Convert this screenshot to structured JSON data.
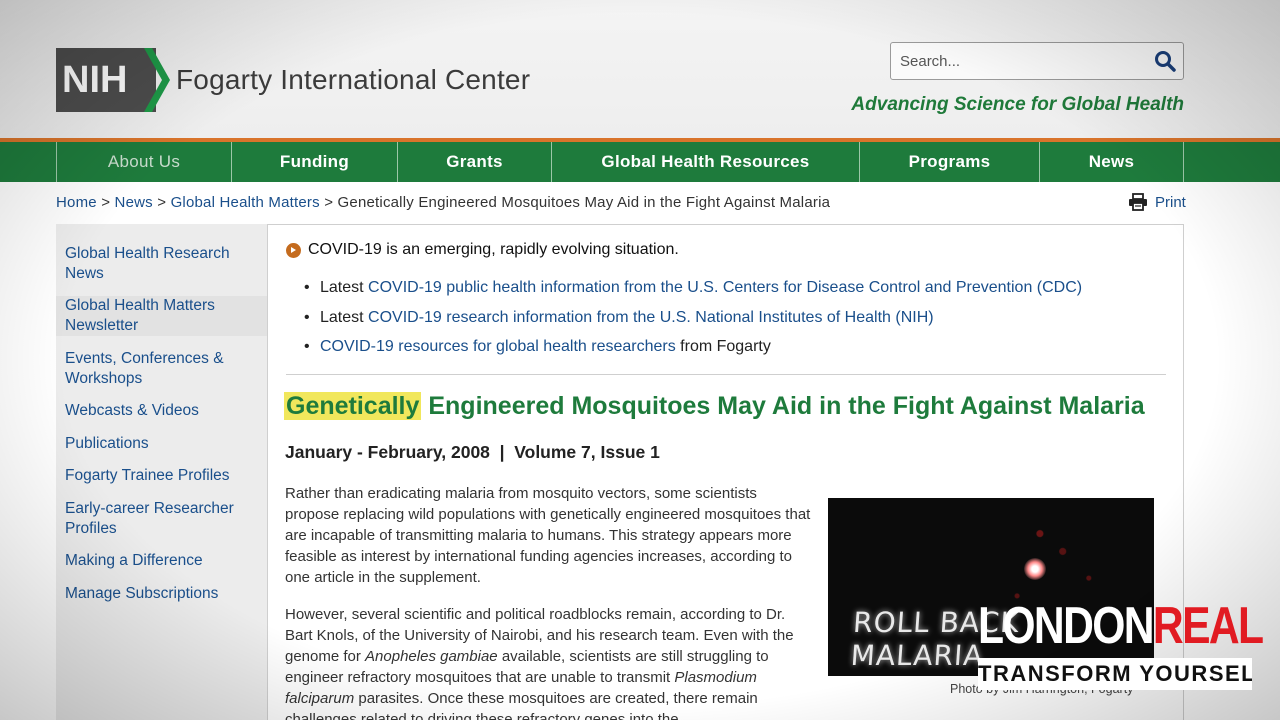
{
  "header": {
    "logo_abbrev": "NIH",
    "org_name": "Fogarty International Center",
    "tagline": "Advancing Science for Global Health",
    "search_placeholder": "Search..."
  },
  "nav": {
    "items": [
      "About Us",
      "Funding",
      "Grants",
      "Global Health Resources",
      "Programs",
      "News"
    ]
  },
  "breadcrumb": {
    "home": "Home",
    "sep": ">",
    "news": "News",
    "ghm": "Global Health Matters",
    "current": "Genetically Engineered Mosquitoes May Aid in the Fight Against Malaria"
  },
  "print_label": "Print",
  "sidebar": {
    "items": [
      "Global Health Research News",
      "Global Health Matters Newsletter",
      "Events, Conferences & Workshops",
      "Webcasts & Videos",
      "Publications",
      "Fogarty Trainee Profiles",
      "Early-career Researcher Profiles",
      "Making a Difference",
      "Manage Subscriptions"
    ]
  },
  "covid": {
    "heading": "COVID-19 is an emerging, rapidly evolving situation.",
    "items": [
      {
        "pre": "Latest ",
        "link": "COVID-19 public health information from the U.S. Centers for Disease Control and Prevention (CDC)",
        "post": ""
      },
      {
        "pre": "Latest ",
        "link": "COVID-19 research information from the U.S. National Institutes of Health (NIH)",
        "post": ""
      },
      {
        "pre": "",
        "link": "COVID-19 resources for global health researchers",
        "post": " from Fogarty"
      }
    ]
  },
  "article": {
    "title_highlight": "Genetically",
    "title_rest": " Engineered Mosquitoes May Aid in the Fight Against Malaria",
    "issue": "January - February, 2008  |  Volume 7, Issue 1",
    "p1": "Rather than eradicating malaria from mosquito vectors, some scientists propose replacing wild populations with genetically engineered mosquitoes that are incapable of transmitting malaria to humans. This strategy appears more feasible as interest by international funding agencies increases, according to one article in the supplement.",
    "p2_a": "However, several scientific and political roadblocks remain, according to Dr. Bart Knols, of the University of Nairobi, and his research team. Even with the genome for ",
    "p2_em1": "Anopheles gambiae",
    "p2_b": " available, scientists are still struggling to engineer refractory mosquitoes that are unable to transmit ",
    "p2_em2": "Plasmodium falciparum",
    "p2_c": " parasites. Once these mosquitoes are created, there remain challenges related to driving these refractory genes into the",
    "photo_text": "ROLL BACK MALARIA",
    "photo_caption": "Photo by Jim Harrington, Fogarty"
  },
  "watermark": {
    "word1": "LONDON",
    "word2": "REAL",
    "subtitle": "TRANSFORM YOURSELF"
  }
}
